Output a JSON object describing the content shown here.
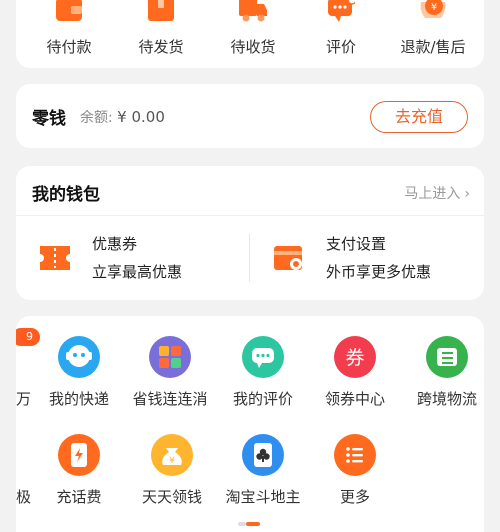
{
  "order_status": {
    "items": [
      {
        "label": "待付款",
        "icon": "wallet-icon"
      },
      {
        "label": "待发货",
        "icon": "package-icon"
      },
      {
        "label": "待收货",
        "icon": "truck-icon"
      },
      {
        "label": "评价",
        "icon": "comment-icon"
      },
      {
        "label": "退款/售后",
        "icon": "refund-icon"
      }
    ]
  },
  "change": {
    "title": "零钱",
    "balance_label": "余额:",
    "balance_value": "¥ 0.00",
    "recharge_label": "去充值"
  },
  "wallet": {
    "title": "我的钱包",
    "link_label": "马上进入",
    "items": [
      {
        "title": "优惠券",
        "subtitle": "立享最高优惠",
        "icon": "coupon-icon"
      },
      {
        "title": "支付设置",
        "subtitle": "外币享更多优惠",
        "icon": "payment-settings-icon"
      }
    ]
  },
  "services": {
    "badge": "9",
    "left_partial_row1": "万",
    "left_partial_row2": "极",
    "row1": [
      {
        "label": "我的快递",
        "icon": "courier-icon"
      },
      {
        "label": "省钱连连消",
        "icon": "match-game-icon"
      },
      {
        "label": "我的评价",
        "icon": "review-icon"
      },
      {
        "label": "领券中心",
        "icon": "voucher-icon"
      },
      {
        "label": "跨境物流",
        "icon": "logistics-icon"
      }
    ],
    "row2": [
      {
        "label": "充话费",
        "icon": "phone-recharge-icon"
      },
      {
        "label": "天天领钱",
        "icon": "money-bag-icon"
      },
      {
        "label": "淘宝斗地主",
        "icon": "poker-icon"
      },
      {
        "label": "更多",
        "icon": "more-icon"
      }
    ]
  },
  "colors": {
    "accent": "#e8642c",
    "background": "#f2f2f2"
  }
}
